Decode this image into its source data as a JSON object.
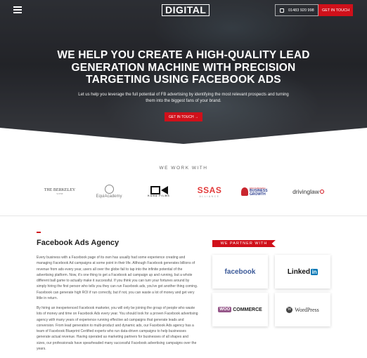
{
  "header": {
    "logo": "DIGITAL",
    "phone": "01483 920 998",
    "cta": "GET IN TOUCH"
  },
  "hero": {
    "title": "WE HELP YOU CREATE A HIGH-QUALITY LEAD GENERATION MACHINE WITH PRECISION TARGETING USING FACEBOOK ADS",
    "subtitle": "Let us help you leverage the full potential of FB advertising by identifying the most relevant prospects and turning them into the biggest fans of your brand.",
    "button": "GET IN TOUCH →"
  },
  "work_with": {
    "title": "WE WORK WITH",
    "logos": [
      {
        "main": "THE BERKELEY",
        "sub": "SCENE"
      },
      {
        "main": "EquiAcademy"
      },
      {
        "main": "KUNA FILMS"
      },
      {
        "main": "SSAS",
        "sub": "ALLIANCE"
      },
      {
        "main": "ENCOURAGING",
        "sub": "BUSINESS GROWTH"
      },
      {
        "main": "drivinglaw"
      }
    ]
  },
  "content": {
    "title": "Facebook Ads Agency",
    "paragraph1": "Every business with a Facebook page of its own has usually had some experience creating and managing Facebook Ad campaigns at some point in their life. Although Facebook generates billions of revenue from ads every year, users all over the globe fail to tap into the infinite potential of the advertising platform. Now, it's one thing to get a Facebook ad campaign up and running, but a whole different ball game to actually make it successful. If you think you can turn your fortunes around by simply hiring the first person who tells you they can run Facebook ads, you've got another thing coming. Facebook can generate high ROI if run correctly, but if not, you can waste a lot of money and get very little in return.",
    "paragraph2": "By hiring an inexperienced Facebook marketer, you will only be joining the group of people who waste lots of money and time on Facebook Ads every year. You should look for a proven Facebook advertising agency with many years of experience running effective ad campaigns that generate leads and conversion. From lead generation to multi-product and dynamic ads, our Facebook Ads agency has a team of Facebook Blueprint Certified experts who run data-driven campaigns to help businesses generate actual revenue. Having operated as marketing partners for businesses of all shapes and sizes, our professionals have spearheaded many successful Facebook advertising campaigns over the years."
  },
  "partners": {
    "title": "WE PARTNER WITH",
    "items": [
      {
        "name": "facebook"
      },
      {
        "name": "Linked",
        "suffix": "in"
      },
      {
        "badge": "WOO",
        "name": "COMMERCE"
      },
      {
        "icon": "W",
        "name": "WordPress"
      }
    ]
  },
  "colors": {
    "accent": "#d0101a",
    "facebook": "#3b5998",
    "linkedin": "#0077b5",
    "woo": "#96588a"
  }
}
